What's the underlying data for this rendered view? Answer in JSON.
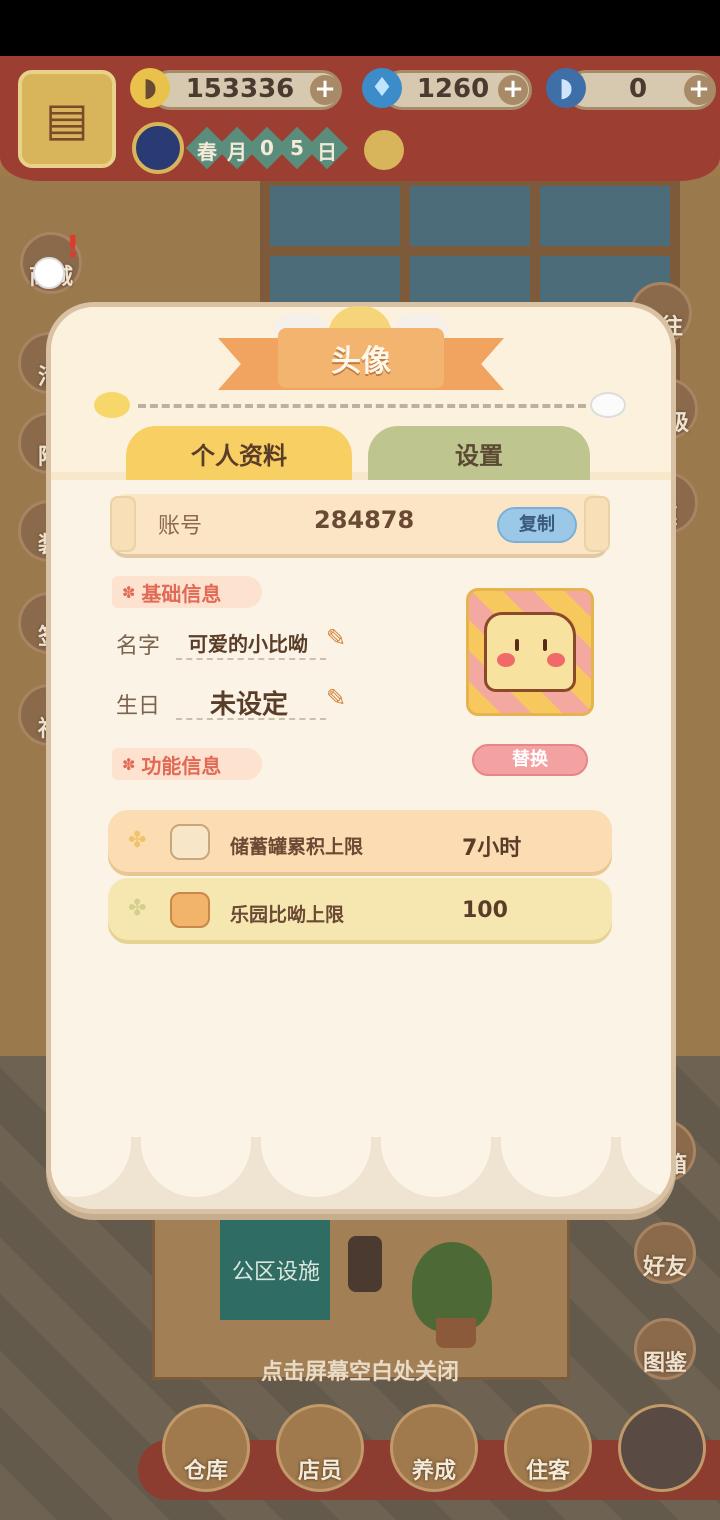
{
  "resources": {
    "banana": {
      "value": "153336",
      "icon": "banana-icon"
    },
    "flame": {
      "value": "1260",
      "icon": "blue-flame-icon"
    },
    "blue_banana": {
      "value": "0",
      "icon": "blue-banana-icon"
    }
  },
  "date": {
    "chars": [
      "春",
      "月",
      "0",
      "5",
      "日"
    ]
  },
  "left_menu": [
    "商城",
    "活",
    "附",
    "装",
    "签",
    "福"
  ],
  "right_menu": [
    "前往",
    "等级",
    "惠",
    "宝箱",
    "好友",
    "图鉴"
  ],
  "scene": {
    "sign": "公区设施",
    "close_hint": "点击屏幕空白处关闭"
  },
  "dock": [
    "仓库",
    "店员",
    "养成",
    "住客"
  ],
  "modal": {
    "title": "头像",
    "tabs": [
      "个人资料",
      "设置"
    ],
    "account": {
      "label": "账号",
      "value": "284878",
      "copy": "复制"
    },
    "basic_section": "基础信息",
    "name": {
      "label": "名字",
      "value": "可爱的小比呦"
    },
    "birthday": {
      "label": "生日",
      "value": "未设定"
    },
    "swap": "替换",
    "function_section": "功能信息",
    "rows": [
      {
        "label": "储蓄罐累积上限",
        "value": "7小时"
      },
      {
        "label": "乐园比呦上限",
        "value": "100"
      }
    ]
  },
  "colors": {
    "accent": "#f0a460",
    "tab_active": "#f8cf63",
    "tab_inactive": "#bfc58f",
    "copy": "#9cc8e8",
    "swap": "#f3a1a1"
  }
}
